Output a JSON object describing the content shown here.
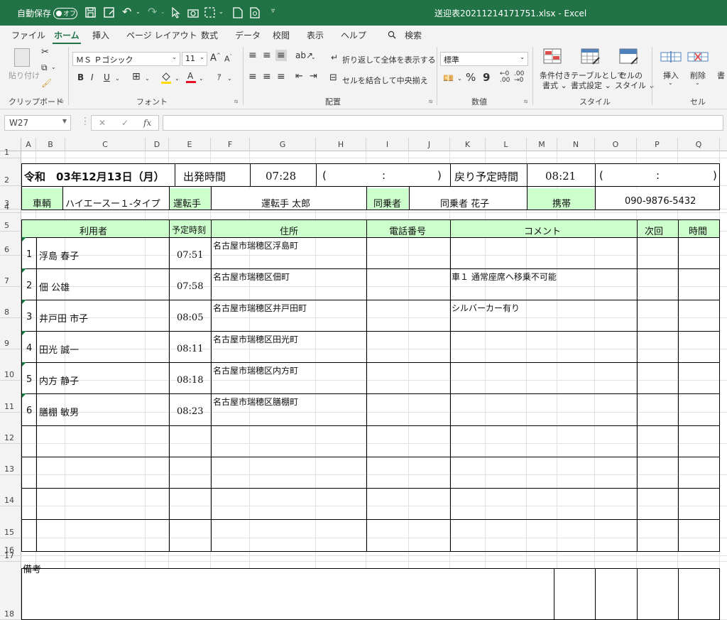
{
  "titlebar": {
    "autosave_label": "自動保存",
    "autosave_state": "オフ",
    "file_title": "送迎表20211214171751.xlsx - Excel"
  },
  "menu": {
    "items": [
      "ファイル",
      "ホーム",
      "挿入",
      "ページ レイアウト",
      "数式",
      "データ",
      "校閲",
      "表示",
      "ヘルプ"
    ],
    "search": "検索",
    "active": "ホーム"
  },
  "ribbon": {
    "clipboard": {
      "paste": "貼り付け",
      "group": "クリップボード"
    },
    "font": {
      "name": "ＭＳ Ｐゴシック",
      "size": "11",
      "bold": "B",
      "italic": "I",
      "underline": "U",
      "group": "フォント"
    },
    "alignment": {
      "wrap": "折り返して全体を表示する",
      "merge": "セルを結合して中央揃え",
      "group": "配置"
    },
    "number": {
      "format": "標準",
      "percent": "%",
      "comma": "9",
      "group": "数値"
    },
    "styles": {
      "conditional": "条件付き\n書式",
      "conditional1": "条件付き",
      "conditional2": "書式 ⌄",
      "table1": "テーブルとして",
      "table2": "書式設定 ⌄",
      "cell1": "セルの",
      "cell2": "スタイル ⌄",
      "group": "スタイル"
    },
    "cells": {
      "insert": "挿入",
      "delete": "削除",
      "group": "セル"
    }
  },
  "formula_bar": {
    "name_box": "W27",
    "fx": "fx",
    "formula": ""
  },
  "columns": [
    "A",
    "B",
    "C",
    "D",
    "E",
    "F",
    "G",
    "H",
    "I",
    "J",
    "K",
    "L",
    "M",
    "N",
    "O",
    "P",
    "Q"
  ],
  "rows": [
    "1",
    "2",
    "3",
    "4",
    "5",
    "6",
    "7",
    "8",
    "9",
    "10",
    "11",
    "12",
    "13",
    "14",
    "15",
    "16",
    "17",
    "18"
  ],
  "sheet": {
    "date": "令和　03年12月13日（月）",
    "depart_label": "出発時間",
    "depart_time": "07:28",
    "paren1_open": "(",
    "paren1_colon": ":",
    "paren1_close": ")",
    "return_label": "戻り予定時間",
    "return_time": "08:21",
    "paren2_open": "(",
    "paren2_colon": ":",
    "paren2_close": ")",
    "vehicle_label": "車輌",
    "vehicle": "ハイエースー１-タイプ",
    "driver_label": "運転手",
    "driver": "運転手 太郎",
    "companion_label": "同乗者",
    "companion": "同乗者 花子",
    "mobile_label": "携帯",
    "mobile": "090-9876-5432",
    "headers": {
      "user": "利用者",
      "scheduled": "予定時刻",
      "address": "住所",
      "phone": "電話番号",
      "comment": "コメント",
      "next": "次回",
      "time": "時間"
    },
    "passengers": [
      {
        "no": "1",
        "name": "浮島 春子",
        "time": "07:51",
        "address": "名古屋市瑞穂区浮島町",
        "comment": ""
      },
      {
        "no": "2",
        "name": "佃 公雄",
        "time": "07:58",
        "address": "名古屋市瑞穂区佃町",
        "comment": "車１ 通常座席へ移乗不可能"
      },
      {
        "no": "3",
        "name": "井戸田 市子",
        "time": "08:05",
        "address": "名古屋市瑞穂区井戸田町",
        "comment": "シルバーカー有り"
      },
      {
        "no": "4",
        "name": "田光 誠一",
        "time": "08:11",
        "address": "名古屋市瑞穂区田光町",
        "comment": ""
      },
      {
        "no": "5",
        "name": "内方 静子",
        "time": "08:18",
        "address": "名古屋市瑞穂区内方町",
        "comment": ""
      },
      {
        "no": "6",
        "name": "膳棚 敏男",
        "time": "08:23",
        "address": "名古屋市瑞穂区膳棚町",
        "comment": ""
      }
    ],
    "remarks_label": "備考"
  }
}
